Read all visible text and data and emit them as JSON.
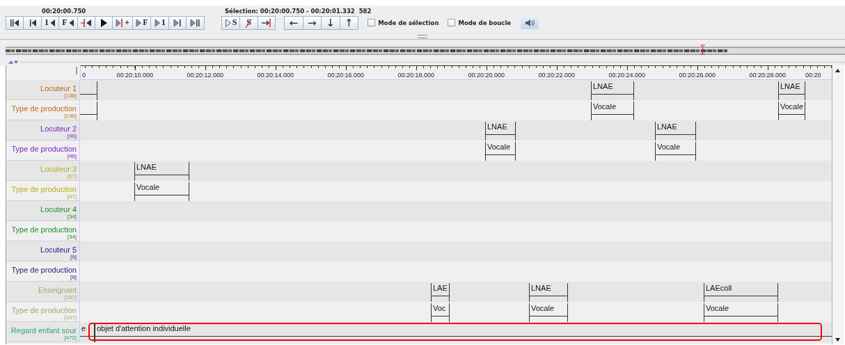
{
  "toolbar": {
    "current_time": "00:20:00.750",
    "selection": "Sélection: 00:20:00.750 - 00:20:01.332  582",
    "player_buttons": [
      {
        "kind": "begin"
      },
      {
        "kind": "bar-left"
      },
      {
        "kind": "text-left",
        "text": "1"
      },
      {
        "kind": "text-left",
        "text": "F"
      },
      {
        "kind": "red-left"
      },
      {
        "kind": "play"
      },
      {
        "kind": "red-right",
        "text": "+"
      },
      {
        "kind": "text-right",
        "text": "F"
      },
      {
        "kind": "text-right",
        "text": "1"
      },
      {
        "kind": "bar-right"
      },
      {
        "kind": "end"
      }
    ],
    "selection_buttons": [
      {
        "kind": "sel-play",
        "text": "S"
      },
      {
        "kind": "clear-sel",
        "text": "S"
      },
      {
        "kind": "sel-end"
      }
    ],
    "navigation_buttons": [
      {
        "kind": "arrow",
        "text": "←"
      },
      {
        "kind": "arrow",
        "text": "→"
      },
      {
        "kind": "arrow",
        "text": "↓"
      },
      {
        "kind": "arrow",
        "text": "↑"
      }
    ],
    "checkboxes": [
      {
        "label": "Mode de sélection",
        "checked": false
      },
      {
        "label": "Mode de boucle",
        "checked": false
      }
    ]
  },
  "overview": {
    "level": 0.83
  },
  "timeline": {
    "ruler": [
      "0",
      "00:20:10.000",
      "00:20:12.000",
      "00:20:14.000",
      "00:20:16.000",
      "00:20:18.000",
      "00:20:20.000",
      "00:20:22.000",
      "00:20:24.000",
      "00:20:26.000",
      "00:20:28.000",
      "00:20"
    ],
    "tracks": [
      {
        "name": "Locuteur 1",
        "count": "[136]",
        "color": "#b86a14",
        "highlighted": false,
        "annotations": [
          {
            "kind": "continued"
          },
          {
            "kind": "segment",
            "value": "LNAE"
          },
          {
            "kind": "segment",
            "value": "LNAE"
          }
        ]
      },
      {
        "name": "Type de production",
        "count": "[136]",
        "color": "#b86a14",
        "highlighted": false,
        "annotations": [
          {
            "kind": "continued"
          },
          {
            "kind": "segment",
            "value": "Vocale"
          },
          {
            "kind": "segment",
            "value": "Vocale"
          }
        ]
      },
      {
        "name": "Locuteur 2",
        "count": "[96]",
        "color": "#7a1fc0",
        "highlighted": false,
        "annotations": [
          {
            "kind": "segment",
            "value": "LNAE"
          },
          {
            "kind": "segment",
            "value": "LNAE"
          }
        ]
      },
      {
        "name": "Type de production",
        "count": "[96]",
        "color": "#7a1fc0",
        "highlighted": false,
        "annotations": [
          {
            "kind": "segment",
            "value": "Vocale"
          },
          {
            "kind": "segment",
            "value": "Vocale"
          }
        ]
      },
      {
        "name": "Locuteur 3",
        "count": "[67]",
        "color": "#b4b018",
        "highlighted": false,
        "annotations": [
          {
            "kind": "segment",
            "value": "LNAE"
          }
        ]
      },
      {
        "name": "Type de production",
        "count": "[67]",
        "color": "#b4b018",
        "highlighted": false,
        "annotations": [
          {
            "kind": "segment",
            "value": "Vocale"
          }
        ]
      },
      {
        "name": "Locuteur 4",
        "count": "[34]",
        "color": "#238a23",
        "highlighted": false
      },
      {
        "name": "Type de production",
        "count": "[34]",
        "color": "#238a23",
        "highlighted": false
      },
      {
        "name": "Locuteur 5",
        "count": "[9]",
        "color": "#1c1c78",
        "highlighted": false
      },
      {
        "name": "Type de production",
        "count": "[9]",
        "color": "#1c1c78",
        "highlighted": false
      },
      {
        "name": "Enseignant",
        "count": "[167]",
        "color": "#a8a470",
        "highlighted": false,
        "annotations": [
          {
            "kind": "segment",
            "value": "LAE"
          },
          {
            "kind": "segment",
            "value": "LNAE"
          },
          {
            "kind": "segment",
            "value": "LAEcoll"
          }
        ]
      },
      {
        "name": "Type de production",
        "count": "[167]",
        "color": "#a8a470",
        "highlighted": false,
        "annotations": [
          {
            "kind": "segment",
            "value": "Voc"
          },
          {
            "kind": "segment",
            "value": "Vocale"
          },
          {
            "kind": "segment",
            "value": "Vocale"
          }
        ]
      },
      {
        "name": "Regard enfant sour",
        "count": "[472]",
        "color": "#2aa86a",
        "highlighted": true,
        "annotations": [
          {
            "kind": "continued",
            "value": "e"
          },
          {
            "kind": "open",
            "value": "objet d'attention individuelle"
          }
        ]
      }
    ]
  }
}
